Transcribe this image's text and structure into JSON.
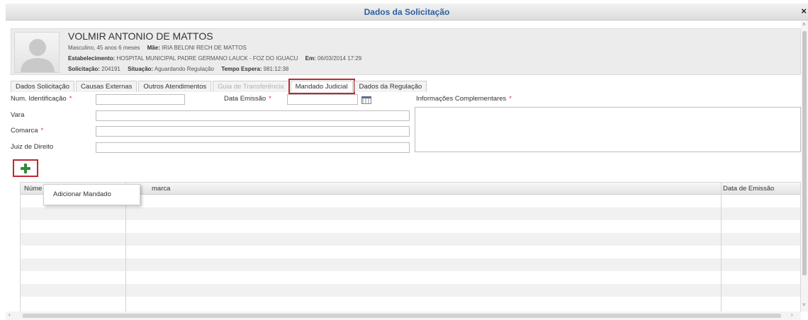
{
  "window": {
    "title": "Dados da Solicitação",
    "close_label": "×"
  },
  "patient": {
    "name": "VOLMIR ANTONIO DE MATTOS",
    "sex_age": "Masculino, 45 anos 6 meses",
    "mother_label": "Mãe:",
    "mother": "IRIA BELONI RECH DE MATTOS",
    "establishment_label": "Estabelecimento:",
    "establishment": "HOSPITAL MUNICIPAL PADRE GERMANO LAUCK - FOZ DO IGUACU",
    "date_label": "Em:",
    "date": "06/03/2014 17:29",
    "request_label": "Solicitação:",
    "request": "204191",
    "status_label": "Situação:",
    "status": "Aguardando Regulação",
    "wait_label": "Tempo Espera:",
    "wait": "981:12:38"
  },
  "tabs": [
    {
      "label": "Dados Solicitação",
      "state": "normal"
    },
    {
      "label": "Causas Externas",
      "state": "normal"
    },
    {
      "label": "Outros Atendimentos",
      "state": "normal"
    },
    {
      "label": "Guia de Transferência",
      "state": "disabled"
    },
    {
      "label": "Mandado Judicial",
      "state": "active"
    },
    {
      "label": "Dados da Regulação",
      "state": "normal"
    }
  ],
  "form": {
    "num_id_label": "Num. Identificação",
    "num_id_value": "",
    "emission_label": "Data Emissão",
    "emission_value": "",
    "info_label": "Informações Complementares",
    "info_value": "",
    "vara_label": "Vara",
    "vara_value": "",
    "comarca_label": "Comarca",
    "comarca_value": "",
    "juiz_label": "Juiz de Direito",
    "juiz_value": "",
    "required_mark": "*"
  },
  "grid": {
    "columns": [
      "Núme",
      "marca",
      "Data de Emissão"
    ],
    "rows": []
  },
  "context_menu": {
    "item": "Adicionar Mandado"
  },
  "colors": {
    "highlight": "#c0282f",
    "title": "#2c5fa0",
    "add_icon": "#2f8b3a",
    "required": "#d13b3b"
  }
}
